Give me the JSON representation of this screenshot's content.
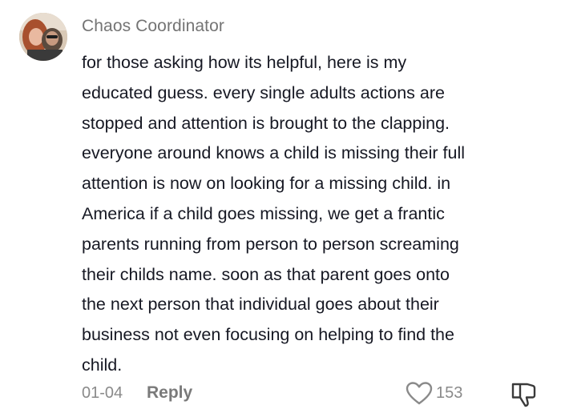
{
  "comment": {
    "username": "Chaos Coordinator",
    "avatar_icon": "user-avatar-photo",
    "text_lines": [
      "for those asking how its helpful, here is my",
      "educated guess. every single adults actions are",
      "stopped and attention is brought to the clapping.",
      "everyone around knows a child is missing their full",
      "attention is now on looking for a missing child. in",
      "America if a child goes missing, we get a frantic",
      "parents running from person to person screaming",
      "their childs name. soon as that parent goes onto",
      "the next person that individual goes about their",
      "business not even focusing on helping to find the",
      "child."
    ],
    "date": "01-04",
    "reply_label": "Reply",
    "like_icon": "heart-icon",
    "like_count": "153",
    "dislike_icon": "thumbs-down-icon"
  },
  "colors": {
    "text": "#161823",
    "muted": "#8a8a8a",
    "background": "#ffffff"
  }
}
